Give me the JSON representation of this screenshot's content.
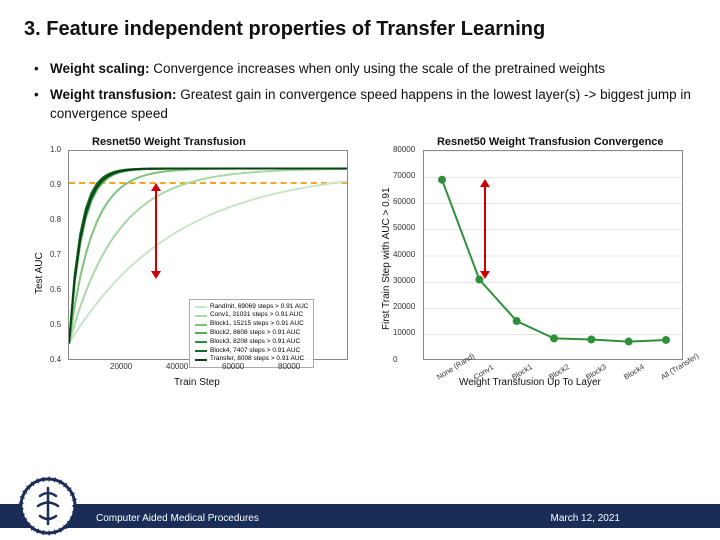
{
  "title": "3. Feature independent properties of Transfer Learning",
  "bullets": [
    {
      "label": "Weight scaling:",
      "text": " Convergence increases when only using the scale of the pretrained weights"
    },
    {
      "label": "Weight transfusion:",
      "text": " Greatest gain in convergence speed happens in the lowest layer(s) -> biggest jump in convergence speed"
    }
  ],
  "footer": {
    "left": "Computer Aided Medical Procedures",
    "right": "March 12, 2021"
  },
  "chart_data": [
    {
      "type": "line",
      "title": "Resnet50 Weight Transfusion",
      "xlabel": "Train Step",
      "ylabel": "Test AUC",
      "xlim": [
        0,
        100000
      ],
      "xticks": [
        20000,
        40000,
        60000,
        80000
      ],
      "ylim": [
        0.4,
        1.0
      ],
      "yticks": [
        0.4,
        0.5,
        0.6,
        0.7,
        0.8,
        0.9,
        1.0
      ],
      "threshold": 0.91,
      "series": [
        {
          "name": "RandInit",
          "steps_to_091": 69069,
          "color": "#c7e6c7"
        },
        {
          "name": "Conv1",
          "steps_to_091": 31031,
          "color": "#a7d8a5"
        },
        {
          "name": "Block1",
          "steps_to_091": 15215,
          "color": "#7cc47a"
        },
        {
          "name": "Block2",
          "steps_to_091": 8608,
          "color": "#54ad55"
        },
        {
          "name": "Block3",
          "steps_to_091": 8208,
          "color": "#2f8f3a"
        },
        {
          "name": "Block4",
          "steps_to_091": 7407,
          "color": "#166b26"
        },
        {
          "name": "Transfer",
          "steps_to_091": 8008,
          "color": "#0a4416"
        }
      ],
      "legend_suffix": " steps > 0.91 AUC"
    },
    {
      "type": "line",
      "title": "Resnet50 Weight Transfusion Convergence",
      "xlabel": "Weight Transfusion Up To Layer",
      "ylabel": "First Train Step with AUC > 0.91",
      "categories": [
        "None (Rand)",
        "Conv1",
        "Block1",
        "Block2",
        "Block3",
        "Block4",
        "All (Transfer)"
      ],
      "values": [
        69069,
        31031,
        15215,
        8608,
        8208,
        7407,
        8008
      ],
      "ylim": [
        0,
        80000
      ],
      "yticks": [
        0,
        10000,
        20000,
        30000,
        40000,
        50000,
        60000,
        70000,
        80000
      ],
      "color": "#2f8f3a"
    }
  ]
}
